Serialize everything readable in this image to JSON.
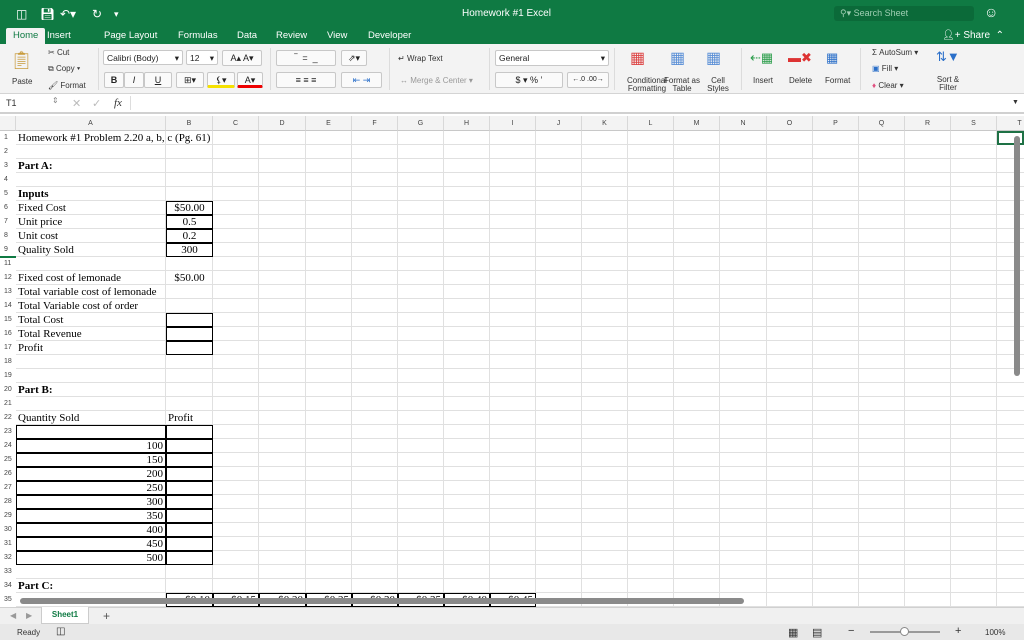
{
  "window": {
    "title": "Homework #1 Excel",
    "search_placeholder": "Search Sheet",
    "share": "Share"
  },
  "tabs": [
    "Home",
    "Insert",
    "Page Layout",
    "Formulas",
    "Data",
    "Review",
    "View",
    "Developer"
  ],
  "ribbon": {
    "paste": "Paste",
    "cut": "Cut",
    "copy": "Copy",
    "format": "Format",
    "font": "Calibri (Body)",
    "size": "12",
    "bold": "B",
    "italic": "I",
    "underline": "U",
    "wrap_text": "Wrap Text",
    "merge_center": "Merge & Center",
    "number_format": "General",
    "currency": "$",
    "percent": "%",
    "comma": "’",
    "conditional_formatting": "Conditional Formatting",
    "format_as_table": "Format as Table",
    "cell_styles": "Cell Styles",
    "insert": "Insert",
    "delete": "Delete",
    "format_cells": "Format",
    "autosum": "AutoSum",
    "fill": "Fill",
    "clear": "Clear",
    "sort_filter": "Sort & Filter"
  },
  "formula_bar": {
    "name_box": "T1",
    "fx": "fx",
    "value": ""
  },
  "columns": [
    "A",
    "B",
    "C",
    "D",
    "E",
    "F",
    "G",
    "H",
    "I",
    "J",
    "K",
    "L",
    "M",
    "N",
    "O",
    "P",
    "Q",
    "R",
    "S",
    "T"
  ],
  "rows": [
    1,
    2,
    3,
    4,
    5,
    6,
    7,
    8,
    9,
    11,
    12,
    13,
    14,
    15,
    16,
    17,
    18,
    19,
    20,
    21,
    22,
    23,
    24,
    25,
    26,
    27,
    28,
    29,
    30,
    31,
    32,
    33,
    34,
    35
  ],
  "cells": [
    {
      "row": 1,
      "col": "A",
      "value": "Homework #1 Problem 2.20 a, b, c (Pg. 61)"
    },
    {
      "row": 3,
      "col": "A",
      "value": "Part A:",
      "bold": true
    },
    {
      "row": 5,
      "col": "A",
      "value": "Inputs",
      "bold": true
    },
    {
      "row": 6,
      "col": "A",
      "value": "Fixed Cost"
    },
    {
      "row": 6,
      "col": "B",
      "value": "$50.00",
      "align": "center",
      "border": true
    },
    {
      "row": 7,
      "col": "A",
      "value": "Unit price"
    },
    {
      "row": 7,
      "col": "B",
      "value": "0.5",
      "align": "center",
      "border": true
    },
    {
      "row": 8,
      "col": "A",
      "value": "Unit cost"
    },
    {
      "row": 8,
      "col": "B",
      "value": "0.2",
      "align": "center",
      "border": true
    },
    {
      "row": 9,
      "col": "A",
      "value": "Quality Sold"
    },
    {
      "row": 9,
      "col": "B",
      "value": "300",
      "align": "center",
      "border": true
    },
    {
      "row": 12,
      "col": "A",
      "value": "Fixed cost of lemonade"
    },
    {
      "row": 12,
      "col": "B",
      "value": "$50.00",
      "align": "center"
    },
    {
      "row": 13,
      "col": "A",
      "value": "Total variable cost of lemonade"
    },
    {
      "row": 14,
      "col": "A",
      "value": "Total Variable cost of order"
    },
    {
      "row": 15,
      "col": "A",
      "value": "Total Cost"
    },
    {
      "row": 15,
      "col": "B",
      "value": "",
      "border": true
    },
    {
      "row": 16,
      "col": "A",
      "value": "Total Revenue"
    },
    {
      "row": 16,
      "col": "B",
      "value": "",
      "border": true
    },
    {
      "row": 17,
      "col": "A",
      "value": "Profit"
    },
    {
      "row": 17,
      "col": "B",
      "value": "",
      "border": true
    },
    {
      "row": 20,
      "col": "A",
      "value": "Part B:",
      "bold": true
    },
    {
      "row": 22,
      "col": "A",
      "value": "Quantity Sold"
    },
    {
      "row": 22,
      "col": "B",
      "value": "Profit"
    },
    {
      "row": 23,
      "col": "A",
      "value": "",
      "border": true
    },
    {
      "row": 23,
      "col": "B",
      "value": "",
      "border": true
    },
    {
      "row": 24,
      "col": "A",
      "value": "100",
      "align": "right",
      "border": true
    },
    {
      "row": 24,
      "col": "B",
      "value": "",
      "border": true
    },
    {
      "row": 25,
      "col": "A",
      "value": "150",
      "align": "right",
      "border": true
    },
    {
      "row": 25,
      "col": "B",
      "value": "",
      "border": true
    },
    {
      "row": 26,
      "col": "A",
      "value": "200",
      "align": "right",
      "border": true
    },
    {
      "row": 26,
      "col": "B",
      "value": "",
      "border": true
    },
    {
      "row": 27,
      "col": "A",
      "value": "250",
      "align": "right",
      "border": true
    },
    {
      "row": 27,
      "col": "B",
      "value": "",
      "border": true
    },
    {
      "row": 28,
      "col": "A",
      "value": "300",
      "align": "right",
      "border": true
    },
    {
      "row": 28,
      "col": "B",
      "value": "",
      "border": true
    },
    {
      "row": 29,
      "col": "A",
      "value": "350",
      "align": "right",
      "border": true
    },
    {
      "row": 29,
      "col": "B",
      "value": "",
      "border": true
    },
    {
      "row": 30,
      "col": "A",
      "value": "400",
      "align": "right",
      "border": true
    },
    {
      "row": 30,
      "col": "B",
      "value": "",
      "border": true
    },
    {
      "row": 31,
      "col": "A",
      "value": "450",
      "align": "right",
      "border": true
    },
    {
      "row": 31,
      "col": "B",
      "value": "",
      "border": true
    },
    {
      "row": 32,
      "col": "A",
      "value": "500",
      "align": "right",
      "border": true
    },
    {
      "row": 32,
      "col": "B",
      "value": "",
      "border": true
    },
    {
      "row": 34,
      "col": "A",
      "value": "Part C:",
      "bold": true
    },
    {
      "row": 35,
      "col": "B",
      "value": "$0.10",
      "align": "right",
      "border": true
    },
    {
      "row": 35,
      "col": "C",
      "value": "$0.15",
      "align": "right",
      "border": true
    },
    {
      "row": 35,
      "col": "D",
      "value": "$0.20",
      "align": "right",
      "border": true
    },
    {
      "row": 35,
      "col": "E",
      "value": "$0.25",
      "align": "right",
      "border": true
    },
    {
      "row": 35,
      "col": "F",
      "value": "$0.30",
      "align": "right",
      "border": true
    },
    {
      "row": 35,
      "col": "G",
      "value": "$0.35",
      "align": "right",
      "border": true
    },
    {
      "row": 35,
      "col": "H",
      "value": "$0.40",
      "align": "right",
      "border": true
    },
    {
      "row": 35,
      "col": "I",
      "value": "$0.45",
      "align": "right",
      "border": true
    }
  ],
  "sheet_tabs": [
    "Sheet1"
  ],
  "add_sheet": "+",
  "status": {
    "ready": "Ready",
    "zoom": "100%"
  },
  "colors": {
    "brand": "#0f7a43"
  }
}
